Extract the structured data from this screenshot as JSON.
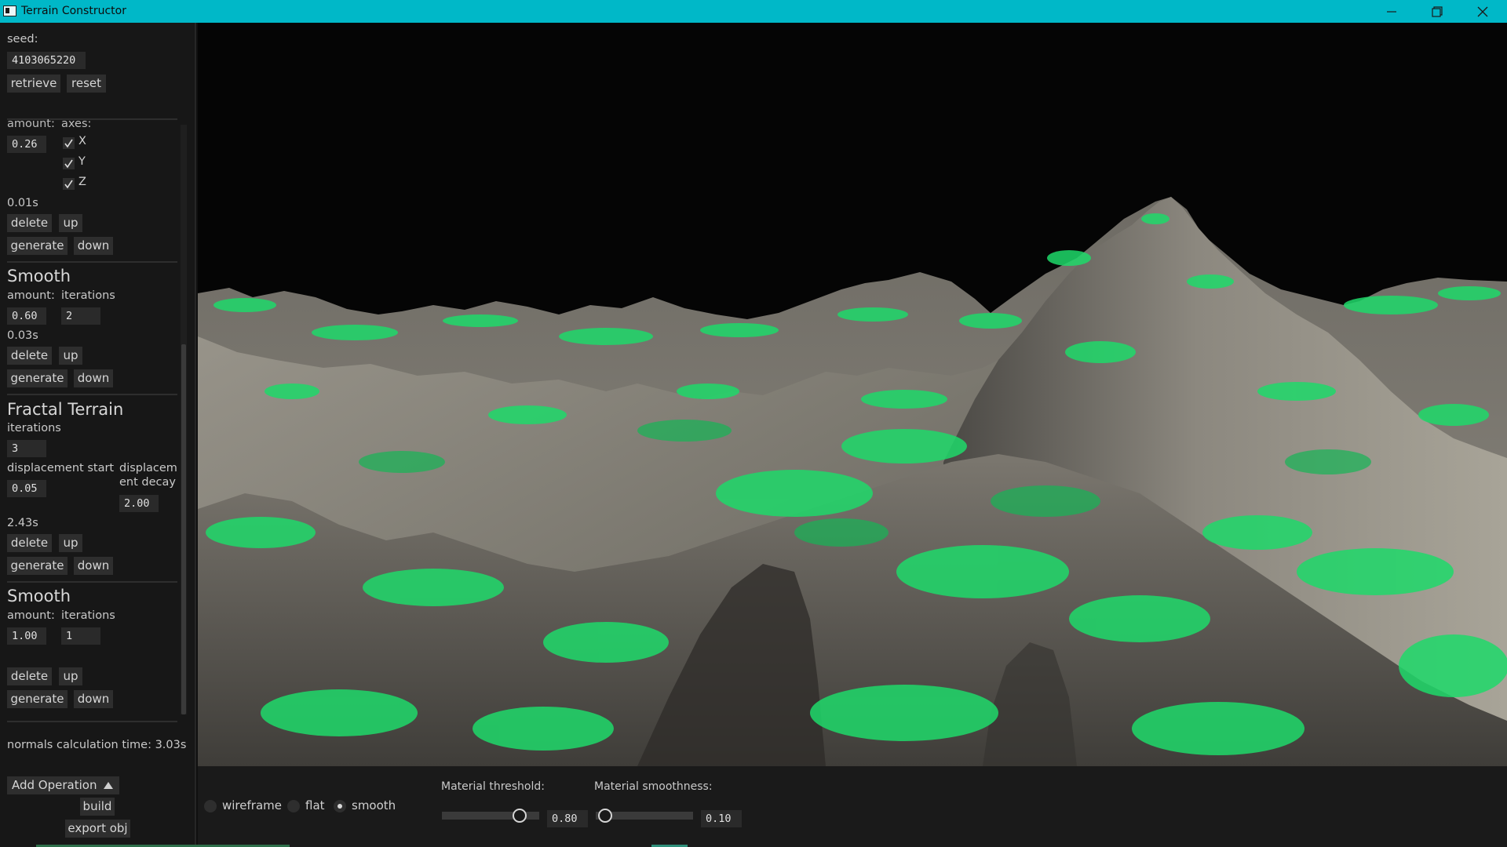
{
  "window": {
    "title": "Terrain Constructor"
  },
  "seed": {
    "label": "seed:",
    "value": "4103065220",
    "retrieve_label": "retrieve",
    "reset_label": "reset"
  },
  "ops": [
    {
      "title": "",
      "amount_label": "amount:",
      "amount_value": "0.26",
      "axes_label": "axes:",
      "axes": [
        {
          "label": "X",
          "checked": true
        },
        {
          "label": "Y",
          "checked": true
        },
        {
          "label": "Z",
          "checked": true
        }
      ],
      "time": "0.01s"
    },
    {
      "title": "Smooth",
      "amount_label": "amount:",
      "amount_value": "0.60",
      "iterations_label": "iterations",
      "iterations_value": "2",
      "time": "0.03s"
    },
    {
      "title": "Fractal Terrain",
      "iterations_label": "iterations",
      "iterations_value": "3",
      "disp_start_label": "displacement start",
      "disp_start_value": "0.05",
      "disp_decay_label_1": "displacem",
      "disp_decay_label_2": "ent decay",
      "disp_decay_value": "2.00",
      "time": "2.43s"
    },
    {
      "title": "Smooth",
      "amount_label": "amount:",
      "amount_value": "1.00",
      "iterations_label": "iterations",
      "iterations_value": "1",
      "time": ""
    }
  ],
  "op_buttons": {
    "delete": "delete",
    "up": "up",
    "generate": "generate",
    "down": "down"
  },
  "normals_time": "normals calculation time: 3.03s",
  "add_operation_label": "Add Operation",
  "build_label": "build",
  "export_label": "export obj",
  "render_modes": {
    "wireframe": "wireframe",
    "flat": "flat",
    "smooth": "smooth",
    "selected": "smooth"
  },
  "material_threshold": {
    "label": "Material threshold:",
    "value": "0.80",
    "level": 0.8
  },
  "material_smoothness": {
    "label": "Material smoothness:",
    "value": "0.10",
    "level": 0.1
  },
  "colors": {
    "titlebar": "#00b8c8",
    "rock": "#8e8a80",
    "grass": "#1fd96a",
    "sky": "#050505",
    "panel": "#171717"
  }
}
